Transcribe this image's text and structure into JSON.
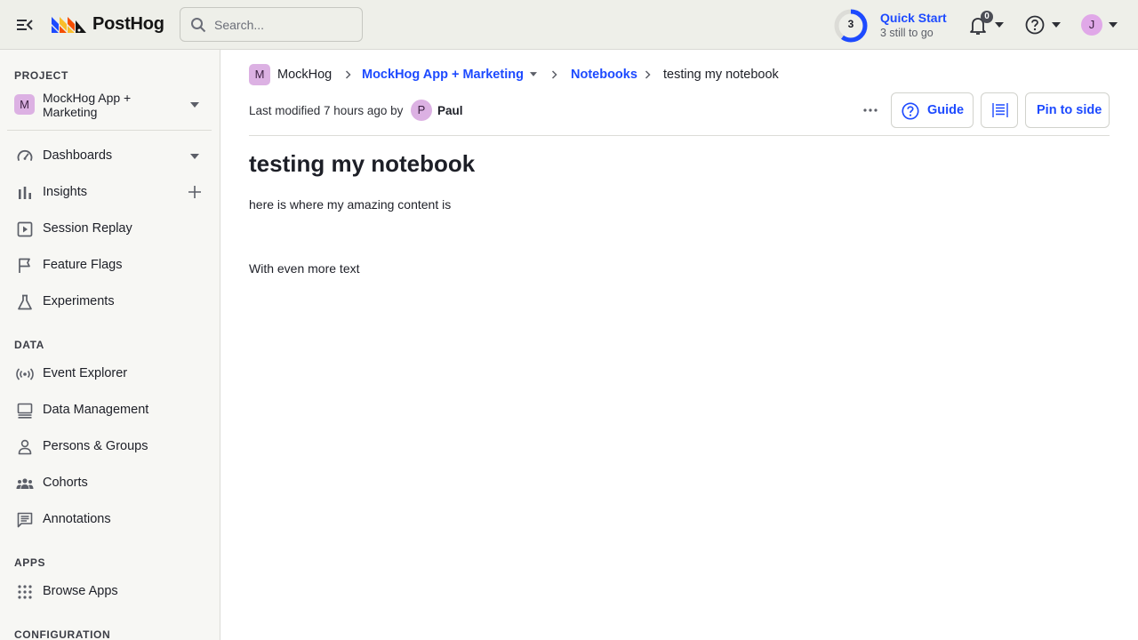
{
  "app": {
    "logo_text": "PostHog",
    "accent_color": "#1d4aff"
  },
  "topbar": {
    "search": {
      "placeholder": "Search..."
    },
    "quick_start": {
      "remaining_count": "3",
      "title": "Quick Start",
      "subtitle": "3 still to go",
      "progress_fraction": 0.6
    },
    "notifications": {
      "count": "0"
    },
    "user": {
      "initial": "J"
    }
  },
  "sidebar": {
    "project_label": "PROJECT",
    "project": {
      "badge": "M",
      "name": "MockHog App + Marketing"
    },
    "main_items": [
      {
        "label": "Dashboards",
        "icon": "dashboard-gauge-icon"
      },
      {
        "label": "Insights",
        "icon": "bar-chart-icon"
      },
      {
        "label": "Session Replay",
        "icon": "play-square-icon"
      },
      {
        "label": "Feature Flags",
        "icon": "flag-icon"
      },
      {
        "label": "Experiments",
        "icon": "flask-icon"
      }
    ],
    "data_label": "DATA",
    "data_items": [
      {
        "label": "Event Explorer",
        "icon": "broadcast-icon"
      },
      {
        "label": "Data Management",
        "icon": "database-icon"
      },
      {
        "label": "Persons & Groups",
        "icon": "person-icon"
      },
      {
        "label": "Cohorts",
        "icon": "users-icon"
      },
      {
        "label": "Annotations",
        "icon": "comment-icon"
      }
    ],
    "apps_label": "APPS",
    "apps_items": [
      {
        "label": "Browse Apps",
        "icon": "apps-grid-icon"
      }
    ],
    "config_label": "CONFIGURATION"
  },
  "breadcrumb": {
    "org_badge": "M",
    "org": "MockHog",
    "project": "MockHog App + Marketing",
    "section": "Notebooks",
    "current": "testing my notebook"
  },
  "notebook": {
    "meta_prefix": "Last modified 7 hours ago by",
    "author_initial": "P",
    "author": "Paul",
    "guide_label": "Guide",
    "pin_label": "Pin to side",
    "title": "testing my notebook",
    "paragraphs": [
      "here is where my amazing content is",
      "With even more text"
    ]
  }
}
